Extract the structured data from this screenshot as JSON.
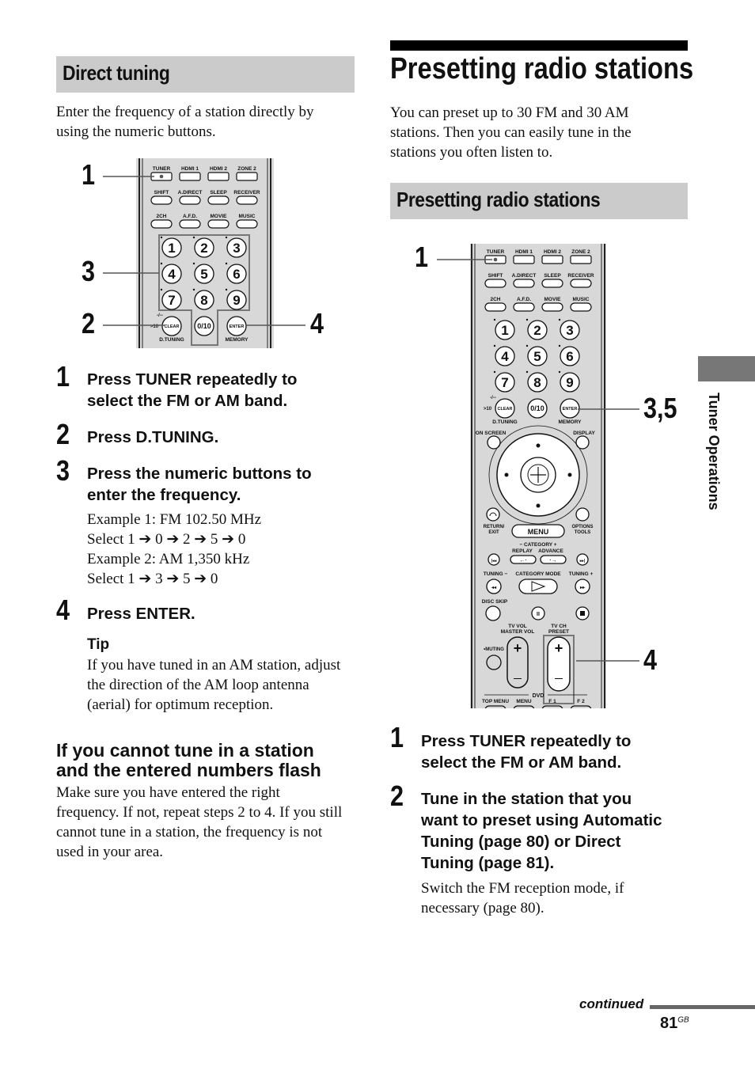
{
  "left": {
    "section_title": "Direct tuning",
    "intro": [
      "Enter the frequency of a station directly by",
      "using the numeric buttons."
    ],
    "callouts": [
      "1",
      "3",
      "2",
      "4"
    ],
    "steps": [
      {
        "num": "1",
        "lines": [
          "Press TUNER repeatedly to",
          "select the FM or AM band."
        ]
      },
      {
        "num": "2",
        "lines": [
          "Press D.TUNING."
        ]
      },
      {
        "num": "3",
        "lines": [
          "Press the numeric buttons to",
          "enter the frequency."
        ],
        "examples": [
          "Example 1: FM 102.50 MHz",
          "Select 1 ➔ 0 ➔ 2 ➔ 5 ➔ 0",
          "Example 2: AM 1,350 kHz",
          "Select 1 ➔ 3 ➔ 5 ➔ 0"
        ]
      },
      {
        "num": "4",
        "lines": [
          "Press ENTER."
        ]
      }
    ],
    "tip_label": "Tip",
    "tip_lines": [
      "If you have tuned in an AM station, adjust",
      "the direction of the AM loop antenna",
      "(aerial) for optimum reception."
    ],
    "sub_heading": [
      "If you cannot tune in a station",
      "and the entered numbers flash"
    ],
    "sub_body": [
      "Make sure you have entered the right",
      "frequency. If not, repeat steps 2 to 4. If you still",
      "cannot tune in a station, the frequency is not",
      "used in your area."
    ]
  },
  "right": {
    "page_title": "Presetting radio stations",
    "intro": [
      "You can preset up to 30 FM and 30 AM",
      "stations. Then you can easily tune in the",
      "stations you often listen to."
    ],
    "section_title": "Presetting radio stations",
    "callouts": [
      "1",
      "3,5",
      "4"
    ],
    "steps": [
      {
        "num": "1",
        "lines": [
          "Press TUNER repeatedly to",
          "select the FM or AM band."
        ]
      },
      {
        "num": "2",
        "lines": [
          "Tune in the station that you",
          "want to preset using Automatic",
          "Tuning (page 80) or Direct",
          "Tuning (page 81)."
        ],
        "note": [
          "Switch the FM reception mode, if",
          "necessary (page 80)."
        ]
      }
    ]
  },
  "remote": {
    "row1": [
      "TUNER",
      "HDMI 1",
      "HDMI 2",
      "ZONE 2"
    ],
    "row2": [
      "SHIFT",
      "A.DIRECT",
      "SLEEP",
      "RECEIVER"
    ],
    "row3": [
      "2CH",
      "A.F.D.",
      "MOVIE",
      "MUSIC"
    ],
    "digits": [
      "1",
      "2",
      "3",
      "4",
      "5",
      "6",
      "7",
      "8",
      "9"
    ],
    "clear": "CLEAR",
    "zero": "0/10",
    "enter": "ENTER",
    "dash": "-/--",
    "gt10": ">10",
    "dtuning": "D.TUNING",
    "memory": "MEMORY",
    "onscreen": "ON SCREEN",
    "display": "DISPLAY",
    "return": [
      "RETURN/",
      "EXIT"
    ],
    "menu": "MENU",
    "options": [
      "OPTIONS",
      "TOOLS"
    ],
    "category": "− CATEGORY +",
    "replay": "REPLAY",
    "advance": "ADVANCE",
    "tuning_minus": "TUNING −",
    "category_mode": "CATEGORY MODE",
    "tuning_plus": "TUNING +",
    "disc_skip": "DISC SKIP",
    "tv_vol": [
      "TV VOL",
      "MASTER VOL"
    ],
    "tv_ch": [
      "TV CH",
      "PRESET"
    ],
    "muting": "•MUTING",
    "dvd": "DVD",
    "bottom": [
      "TOP MENU",
      "MENU",
      "F 1",
      "F 2"
    ]
  },
  "side_tab": {
    "label": "Tuner Operations",
    "color": "#777777"
  },
  "footer": {
    "continued": "continued",
    "page": "81",
    "page_suffix": "GB"
  }
}
